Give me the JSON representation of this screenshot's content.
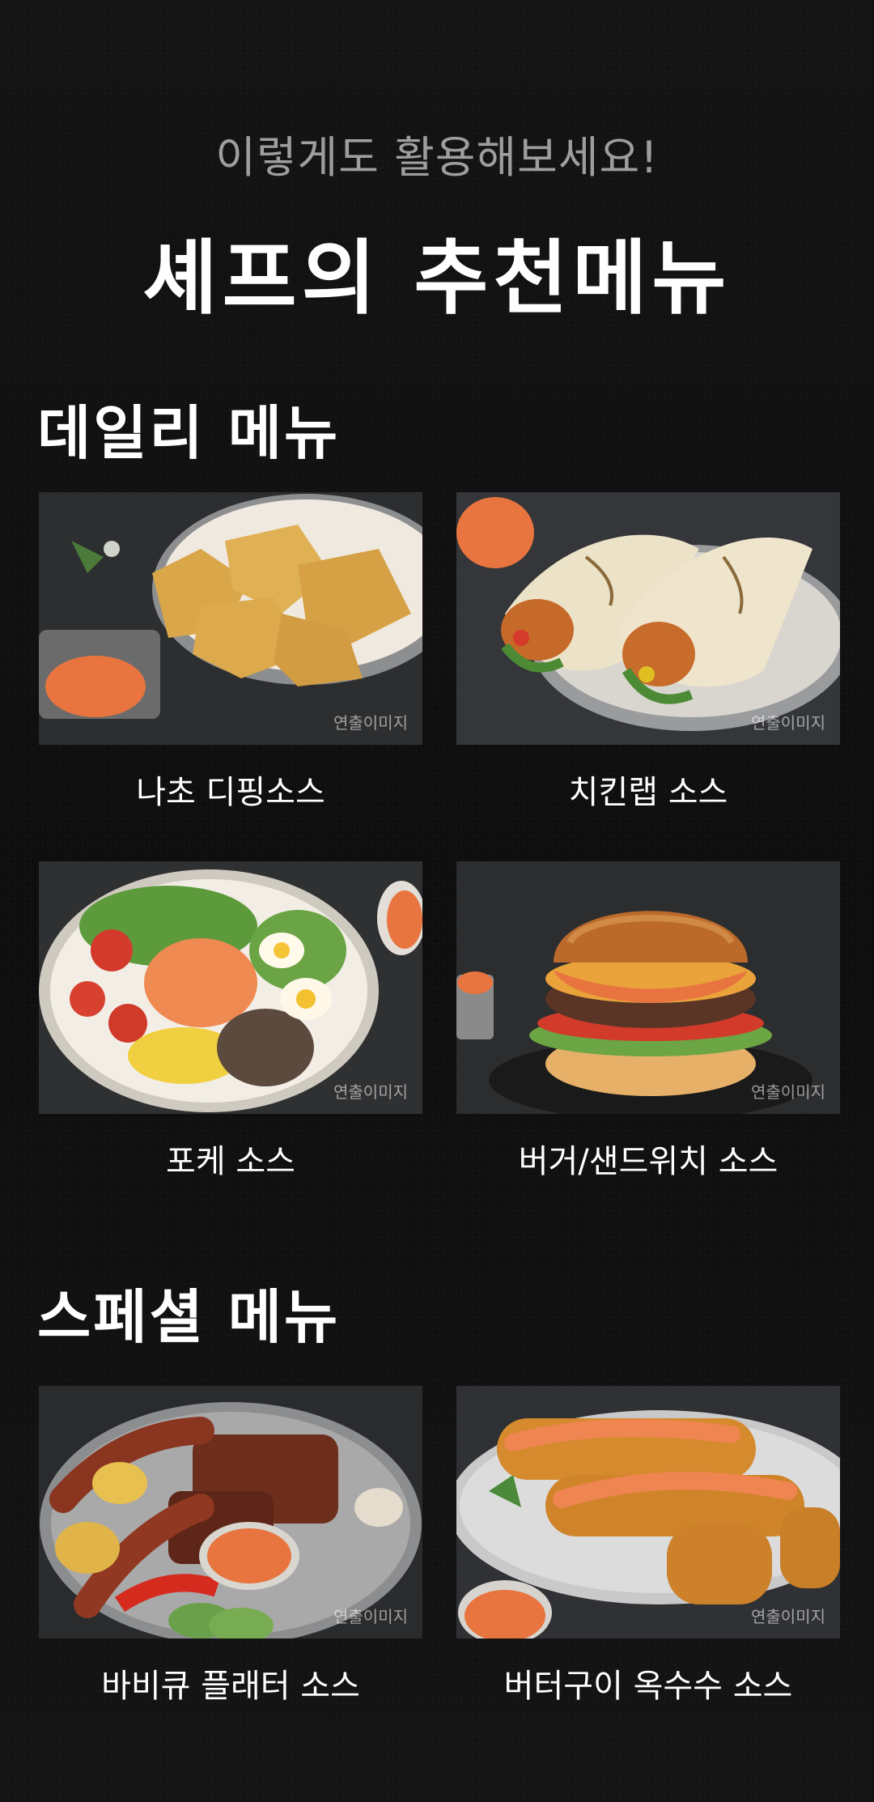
{
  "header": {
    "subtitle": "이렇게도 활용해보세요!",
    "title": "셰프의 추천메뉴"
  },
  "daily": {
    "title": "데일리 메뉴",
    "items": [
      {
        "caption": "나초 디핑소스",
        "watermark": "연출이미지"
      },
      {
        "caption": "치킨랩 소스",
        "watermark": "연출이미지"
      },
      {
        "caption": "포케 소스",
        "watermark": "연출이미지"
      },
      {
        "caption": "버거/샌드위치 소스",
        "watermark": "연출이미지"
      }
    ]
  },
  "special": {
    "title": "스페셜 메뉴",
    "items": [
      {
        "caption": "바비큐 플래터 소스",
        "watermark": "연출이미지"
      },
      {
        "caption": "버터구이 옥수수 소스",
        "watermark": "연출이미지"
      }
    ]
  },
  "colors": {
    "sauce": "#e8743f",
    "background": "#111111"
  }
}
